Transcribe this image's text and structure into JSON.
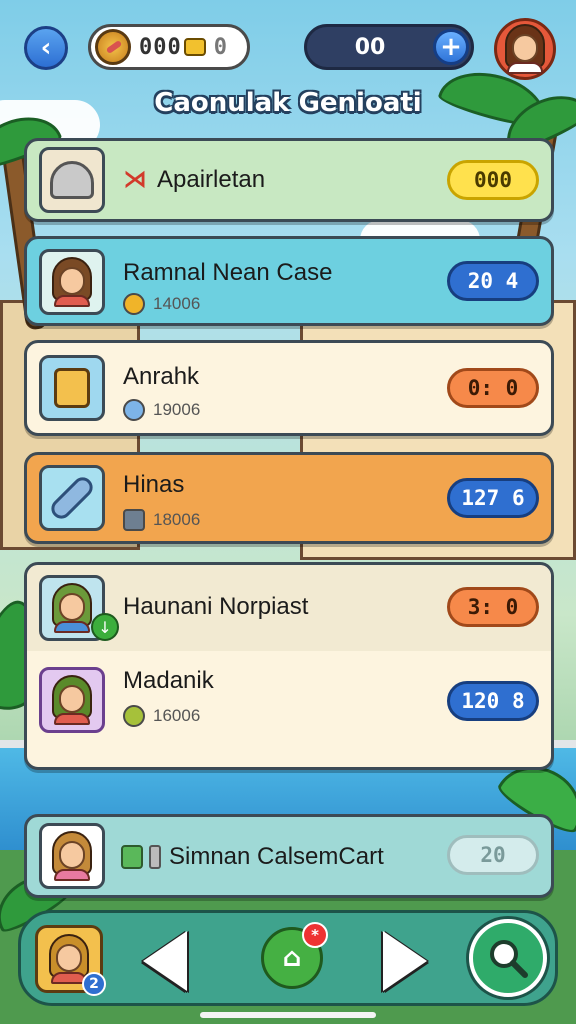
{
  "topbar": {
    "back_icon": "chevron-left-icon",
    "coins": "000",
    "coin_extra": "0",
    "gems": "00",
    "add_icon": "plus-icon",
    "profile_icon": "avatar-icon"
  },
  "title": "Caonulak Genioati",
  "rows": [
    {
      "name": "Apairletan",
      "score": "000",
      "prefix_icon": "red-flag-icon",
      "icon": "helmet-icon",
      "bg": "#c8e8c2",
      "score_color": "yellow"
    },
    {
      "name": "Ramnal Nean Case",
      "sub": "14006",
      "score": "20 4",
      "icon": "woman-avatar-icon",
      "bg": "#6dd0e0",
      "score_color": "blue"
    },
    {
      "name": "Anrahk",
      "sub": "19006",
      "score": "0: 0",
      "icon": "robot-icon",
      "bg": "#fdf4df",
      "score_color": "orange"
    },
    {
      "name": "Hinas",
      "sub": "18006",
      "score": "127 6",
      "icon": "rocket-icon",
      "bg": "#f2a54e",
      "score_color": "blue"
    },
    {
      "name": "Haunani Norpiast",
      "score": "3: 0",
      "icon": "boy-avatar-icon",
      "bg": "#f2ead2",
      "score_color": "orange"
    },
    {
      "name": "Madanik",
      "sub": "16006",
      "score": "120 8",
      "icon": "girl-avatar-icon",
      "bg": "#fdf4df",
      "score_color": "blue"
    },
    {
      "name": "Simnan CalsemCart",
      "score": "20",
      "icon": "kid-avatar-icon",
      "bg": "#9fd9d6",
      "score_color": "pale"
    }
  ],
  "bottom_nav": {
    "avatar_badge": "2",
    "home_notif": "*",
    "prev_icon": "triangle-left-icon",
    "home_icon": "home-icon",
    "next_icon": "triangle-right-icon",
    "search_icon": "search-icon"
  }
}
